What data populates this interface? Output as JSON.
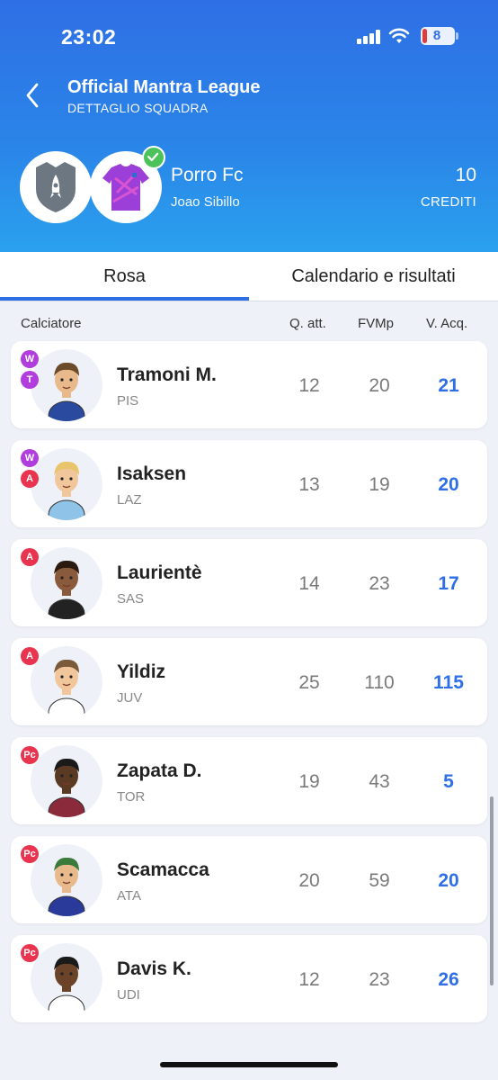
{
  "status": {
    "time": "23:02",
    "battery": "8"
  },
  "header": {
    "title": "Official Mantra League",
    "subtitle": "DETTAGLIO SQUADRA",
    "team_name": "Porro Fc",
    "manager": "Joao Sibillo",
    "credits_value": "10",
    "credits_label": "CREDITI"
  },
  "tabs": [
    {
      "label": "Rosa",
      "active": true
    },
    {
      "label": "Calendario e risultati",
      "active": false
    }
  ],
  "columns": {
    "player": "Calciatore",
    "q": "Q. att.",
    "fvm": "FVMp",
    "v": "V. Acq."
  },
  "colors": {
    "accent": "#2f6fe6",
    "role_purple": "#b23ddd",
    "role_red": "#e8344f",
    "check": "#4cc35a"
  },
  "players": [
    {
      "name": "Tramoni M.",
      "team": "PIS",
      "q": "12",
      "fvm": "20",
      "v": "21",
      "roles": [
        "W",
        "T"
      ],
      "role_colors": [
        "purple",
        "purple"
      ]
    },
    {
      "name": "Isaksen",
      "team": "LAZ",
      "q": "13",
      "fvm": "19",
      "v": "20",
      "roles": [
        "W",
        "A"
      ],
      "role_colors": [
        "purple",
        "red"
      ]
    },
    {
      "name": "Laurientè",
      "team": "SAS",
      "q": "14",
      "fvm": "23",
      "v": "17",
      "roles": [
        "A"
      ],
      "role_colors": [
        "red"
      ]
    },
    {
      "name": "Yildiz",
      "team": "JUV",
      "q": "25",
      "fvm": "110",
      "v": "115",
      "roles": [
        "A"
      ],
      "role_colors": [
        "red"
      ]
    },
    {
      "name": "Zapata D.",
      "team": "TOR",
      "q": "19",
      "fvm": "43",
      "v": "5",
      "roles": [
        "Pc"
      ],
      "role_colors": [
        "red"
      ]
    },
    {
      "name": "Scamacca",
      "team": "ATA",
      "q": "20",
      "fvm": "59",
      "v": "20",
      "roles": [
        "Pc"
      ],
      "role_colors": [
        "red"
      ]
    },
    {
      "name": "Davis K.",
      "team": "UDI",
      "q": "12",
      "fvm": "23",
      "v": "26",
      "roles": [
        "Pc"
      ],
      "role_colors": [
        "red"
      ]
    }
  ]
}
